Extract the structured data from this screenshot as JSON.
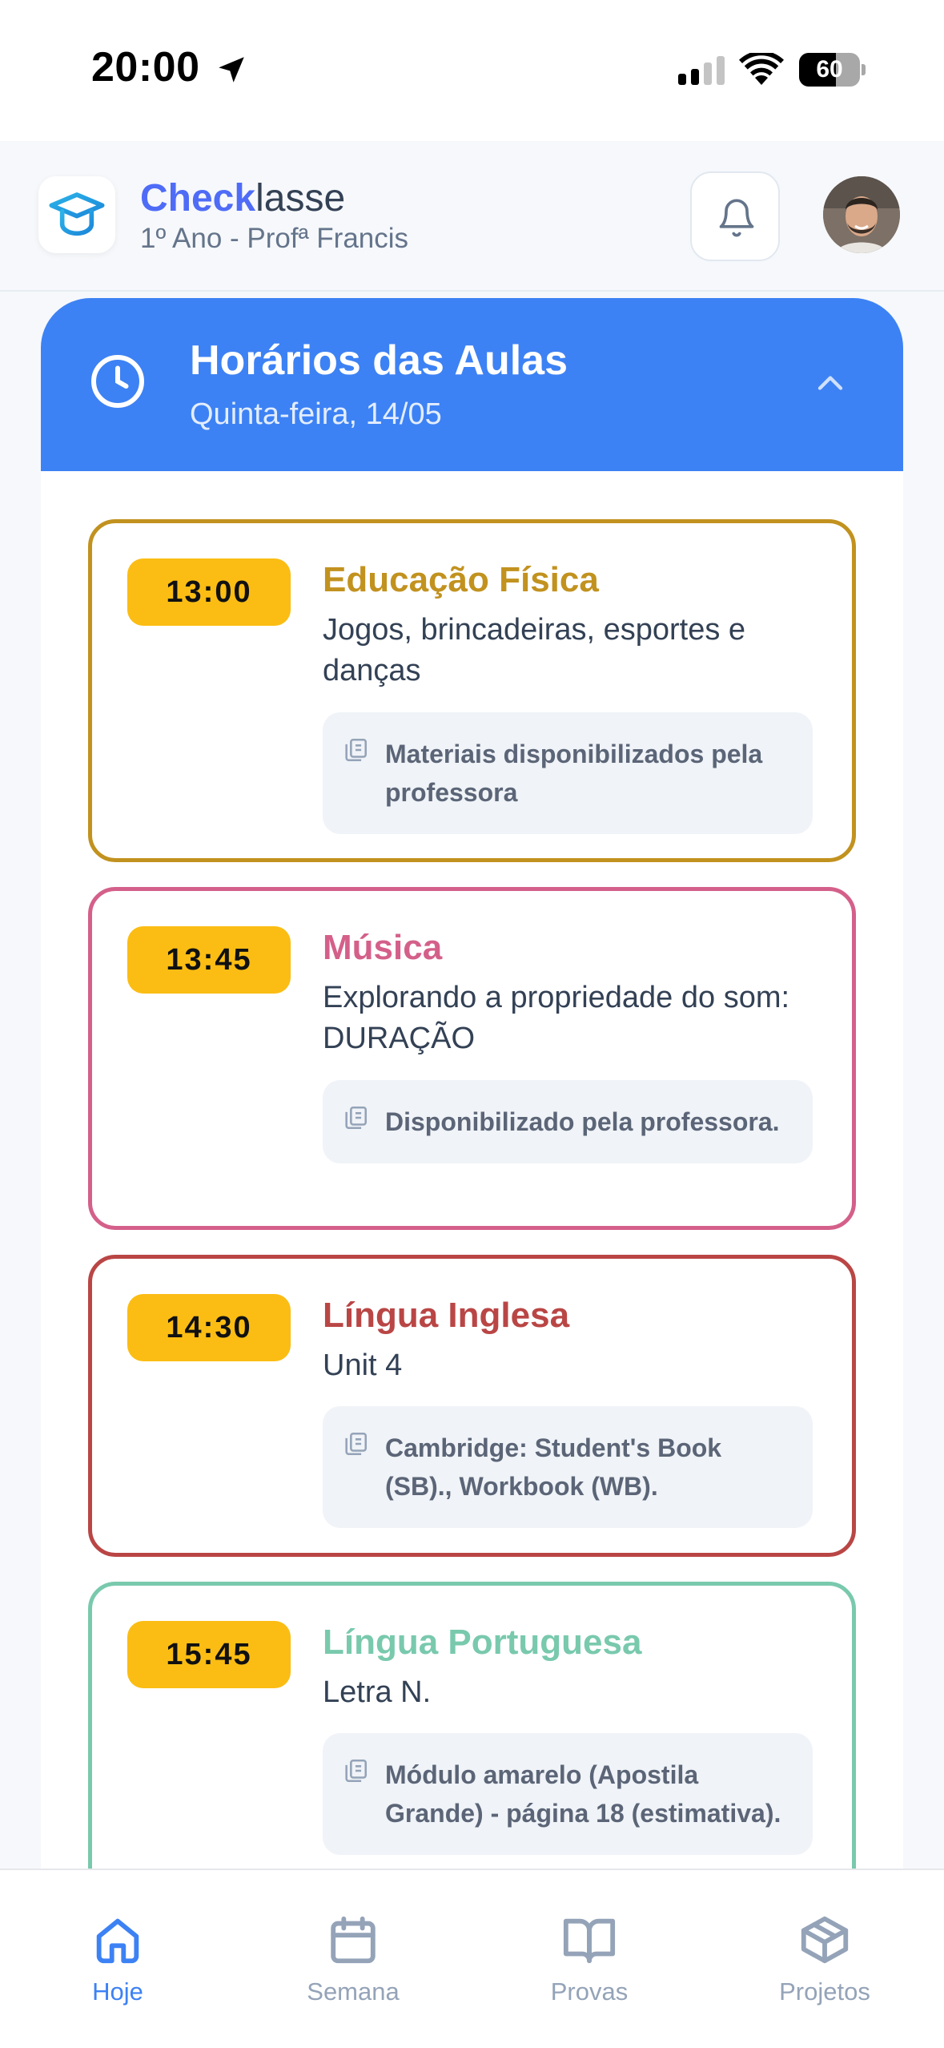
{
  "status_bar": {
    "time": "20:00",
    "battery_level": "60",
    "battery_fraction": 0.6,
    "icons": [
      "location-arrow-icon",
      "cellular-signal-icon",
      "wifi-icon",
      "battery-icon"
    ]
  },
  "header": {
    "brand_bold": "Check",
    "brand_rest": "lasse",
    "subtitle": "1º Ano - Profª Francis",
    "logo_icon": "graduation-cap-icon",
    "notification_icon": "bell-icon"
  },
  "schedule": {
    "title": "Horários das Aulas",
    "date": "Quinta-feira, 14/05",
    "icon": "clock-icon",
    "toggle_icon": "chevron-up-icon",
    "lessons": [
      {
        "time": "13:00",
        "subject": "Educação Física",
        "description": "Jogos, brincadeiras, esportes e danças",
        "materials": "Materiais disponibilizados pela professora",
        "color": "#c2921f"
      },
      {
        "time": "13:45",
        "subject": "Música",
        "description": "Explorando a propriedade do som: DURAÇÃO",
        "materials": "Disponibilizado pela professora.",
        "color": "#d4608a"
      },
      {
        "time": "14:30",
        "subject": "Língua Inglesa",
        "description": "Unit 4",
        "materials": "Cambridge: Student's Book (SB)., Workbook (WB).",
        "color": "#b94645"
      },
      {
        "time": "15:45",
        "subject": "Língua Portuguesa",
        "description": "Letra N.",
        "materials": "Módulo amarelo (Apostila Grande) - página 18 (estimativa).",
        "color": "#79c9ad"
      }
    ]
  },
  "nav": {
    "active_color": "#3d82f4",
    "inactive_color": "#94a3b8",
    "items": [
      {
        "label": "Hoje",
        "icon": "home-icon",
        "active": true
      },
      {
        "label": "Semana",
        "icon": "calendar-icon",
        "active": false
      },
      {
        "label": "Provas",
        "icon": "book-open-icon",
        "active": false
      },
      {
        "label": "Projetos",
        "icon": "package-icon",
        "active": false
      }
    ]
  }
}
